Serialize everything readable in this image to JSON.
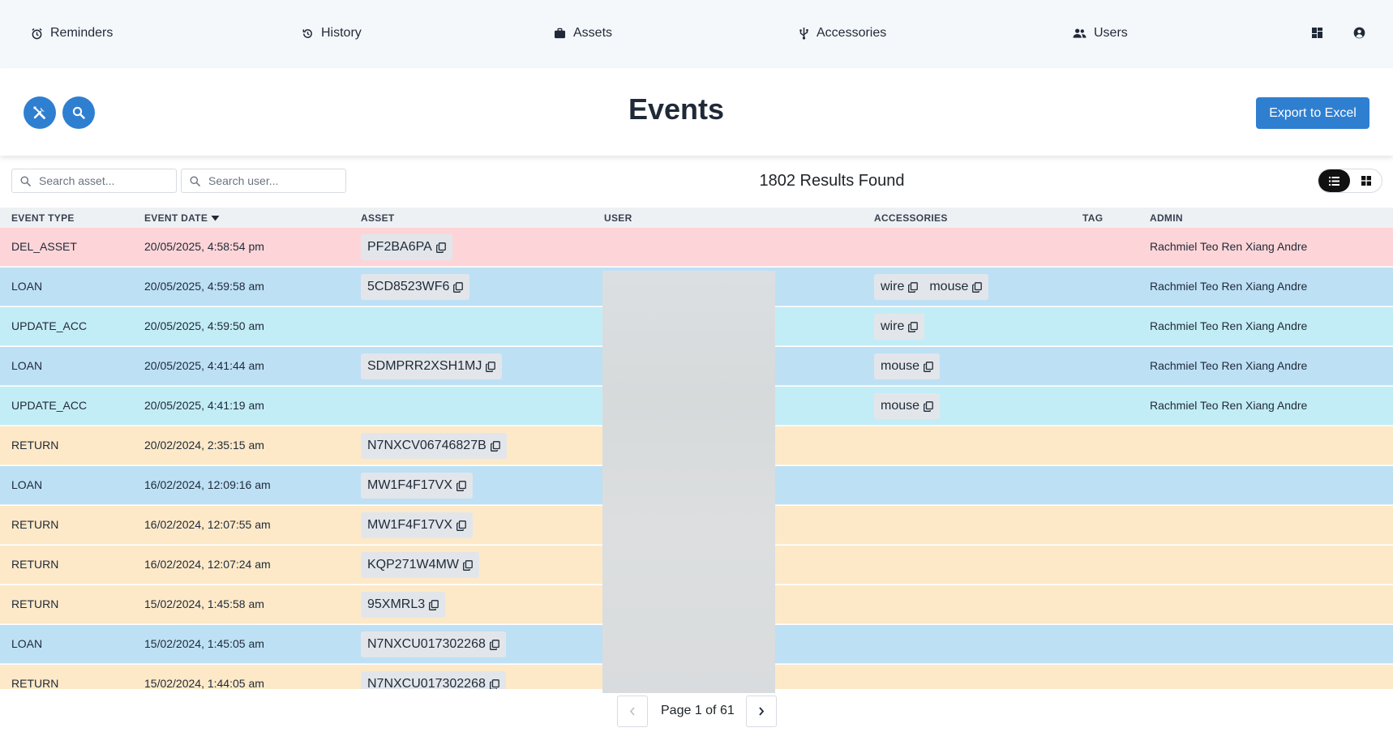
{
  "nav": {
    "items": [
      {
        "label": "Reminders",
        "icon": "alarm-clock-icon"
      },
      {
        "label": "History",
        "icon": "history-icon"
      },
      {
        "label": "Assets",
        "icon": "briefcase-icon"
      },
      {
        "label": "Accessories",
        "icon": "usb-icon"
      },
      {
        "label": "Users",
        "icon": "users-icon"
      }
    ],
    "right_icons": [
      "dashboard-icon",
      "account-icon"
    ]
  },
  "header": {
    "title": "Events",
    "export_label": "Export to Excel",
    "left_buttons": [
      "tools-icon",
      "search-icon"
    ]
  },
  "filters": {
    "asset_placeholder": "Search asset...",
    "user_placeholder": "Search user...",
    "results_text": "1802 Results Found"
  },
  "table": {
    "columns": {
      "event_type": "EVENT TYPE",
      "event_date": "EVENT DATE",
      "asset": "ASSET",
      "user": "USER",
      "accessories": "ACCESSORIES",
      "tag": "TAG",
      "admin": "ADMIN"
    },
    "sort_indicator": "descending",
    "rows": [
      {
        "type": "DEL_ASSET",
        "date": "20/05/2025, 4:58:54 pm",
        "asset": "PF2BA6PA",
        "accessories": [],
        "tag": "",
        "admin": "Rachmiel Teo Ren Xiang Andre",
        "color": "#fdd5d8"
      },
      {
        "type": "LOAN",
        "date": "20/05/2025, 4:59:58 am",
        "asset": "5CD8523WF6",
        "accessories": [
          "wire",
          "mouse"
        ],
        "tag": "",
        "admin": "Rachmiel Teo Ren Xiang Andre",
        "color": "#bde0f5"
      },
      {
        "type": "UPDATE_ACC",
        "date": "20/05/2025, 4:59:50 am",
        "asset": "",
        "accessories": [
          "wire"
        ],
        "tag": "",
        "admin": "Rachmiel Teo Ren Xiang Andre",
        "color": "#c3edf6"
      },
      {
        "type": "LOAN",
        "date": "20/05/2025, 4:41:44 am",
        "asset": "SDMPRR2XSH1MJ",
        "accessories": [
          "mouse"
        ],
        "tag": "",
        "admin": "Rachmiel Teo Ren Xiang Andre",
        "color": "#bde0f5"
      },
      {
        "type": "UPDATE_ACC",
        "date": "20/05/2025, 4:41:19 am",
        "asset": "",
        "accessories": [
          "mouse"
        ],
        "tag": "",
        "admin": "Rachmiel Teo Ren Xiang Andre",
        "color": "#c3edf6"
      },
      {
        "type": "RETURN",
        "date": "20/02/2024, 2:35:15 am",
        "asset": "N7NXCV06746827B",
        "accessories": [],
        "tag": "",
        "admin": "",
        "color": "#fde9c8"
      },
      {
        "type": "LOAN",
        "date": "16/02/2024, 12:09:16 am",
        "asset": "MW1F4F17VX",
        "accessories": [],
        "tag": "",
        "admin": "",
        "color": "#bde0f5"
      },
      {
        "type": "RETURN",
        "date": "16/02/2024, 12:07:55 am",
        "asset": "MW1F4F17VX",
        "accessories": [],
        "tag": "",
        "admin": "",
        "color": "#fde9c8"
      },
      {
        "type": "RETURN",
        "date": "16/02/2024, 12:07:24 am",
        "asset": "KQP271W4MW",
        "accessories": [],
        "tag": "",
        "admin": "",
        "color": "#fde9c8"
      },
      {
        "type": "RETURN",
        "date": "15/02/2024, 1:45:58 am",
        "asset": "95XMRL3",
        "accessories": [],
        "tag": "",
        "admin": "",
        "color": "#fde9c8"
      },
      {
        "type": "LOAN",
        "date": "15/02/2024, 1:45:05 am",
        "asset": "N7NXCU017302268",
        "accessories": [],
        "tag": "",
        "admin": "",
        "color": "#bde0f5"
      },
      {
        "type": "RETURN",
        "date": "15/02/2024, 1:44:05 am",
        "asset": "N7NXCU017302268",
        "accessories": [],
        "tag": "",
        "admin": "",
        "color": "#fde9c8"
      }
    ]
  },
  "pagination": {
    "label": "Page 1 of 61",
    "prev_enabled": false,
    "next_enabled": true
  },
  "colors": {
    "accent": "#2f7fd1",
    "del_asset": "#fdd5d8",
    "loan": "#bde0f5",
    "update_acc": "#c3edf6",
    "return": "#fde9c8"
  }
}
